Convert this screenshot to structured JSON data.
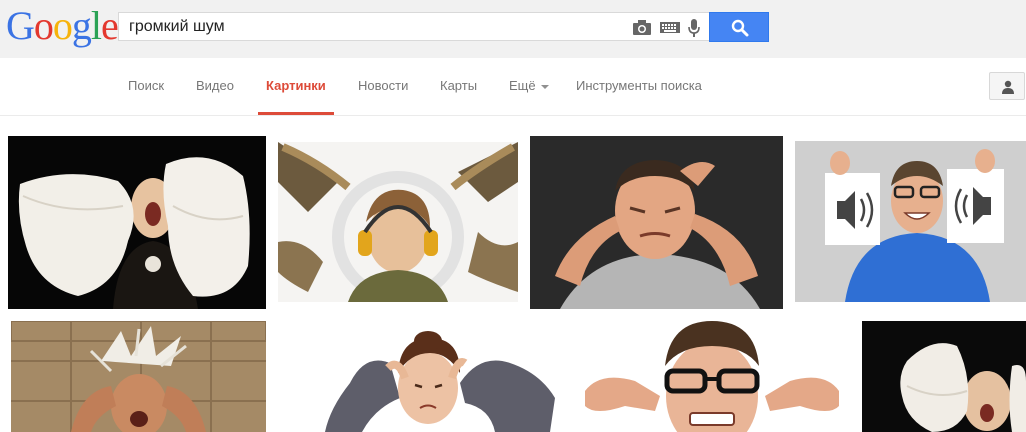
{
  "logo": {
    "letters": [
      "G",
      "o",
      "o",
      "g",
      "l",
      "e"
    ],
    "colors": [
      "#3b73e4",
      "#e3382e",
      "#f6b30c",
      "#3b73e4",
      "#2aa255",
      "#e3382e"
    ]
  },
  "search": {
    "query": "громкий шум"
  },
  "nav": {
    "items": [
      "Поиск",
      "Видео",
      "Картинки",
      "Новости",
      "Карты",
      "Ещё",
      "Инструменты поиска"
    ],
    "active": "Картинки"
  },
  "icons": {
    "camera": "camera-icon",
    "keyboard": "keyboard-icon",
    "microphone": "microphone-icon",
    "search": "search-icon",
    "account": "person-icon"
  },
  "colors": {
    "accent": "#dd4b39",
    "search_button": "#4585f3",
    "topbar": "#f1f1f1"
  },
  "results": [
    {
      "subject": "woman-with-pillows"
    },
    {
      "subject": "boy-with-headphones-saxophones"
    },
    {
      "subject": "man-fingers-in-ears"
    },
    {
      "subject": "man-holding-speaker-signs"
    },
    {
      "subject": "man-head-exploding"
    },
    {
      "subject": "woman-covering-ears"
    },
    {
      "subject": "man-glasses-fingers-in-ears"
    },
    {
      "subject": "woman-pillow-partial"
    }
  ]
}
